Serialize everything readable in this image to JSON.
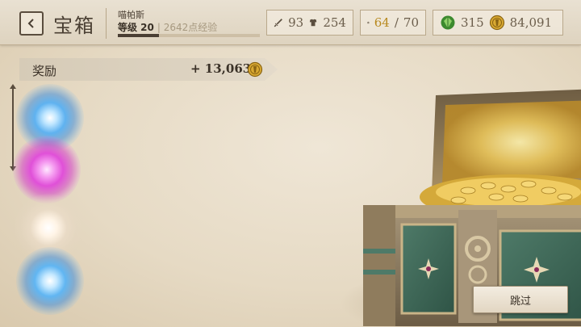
{
  "header": {
    "back_icon": "chevron-left-icon",
    "title": "宝箱",
    "player_name": "喵帕斯",
    "level_label": "等级 20",
    "xp_text": "| 2642点经验",
    "xp_progress": 0.29
  },
  "stats": {
    "attack": {
      "icon": "sword-icon",
      "value": "93"
    },
    "armor": {
      "icon": "armor-icon",
      "value": "254"
    },
    "inventory": {
      "icon": "backpack-icon",
      "current": "64",
      "separator": "/",
      "max": "70"
    },
    "gems": {
      "icon": "green-gem-icon",
      "value": "315"
    },
    "gold": {
      "icon": "gold-coin-icon",
      "value": "84,091"
    }
  },
  "reward": {
    "label": "奖励",
    "amount": "+ 13,063",
    "icon": "gold-coin-icon"
  },
  "reward_items": [
    {
      "name": "blue-magic-orb",
      "color": "#5fb2f0"
    },
    {
      "name": "pink-magic-orb",
      "color": "#e050d8"
    },
    {
      "name": "white-magic-orb",
      "color": "#f3e6d6"
    },
    {
      "name": "blue-magic-orb",
      "color": "#61b6f2"
    }
  ],
  "skip_button": {
    "label": "跳过"
  },
  "colors": {
    "text_dark": "#3a3127",
    "gold": "#b8891f",
    "chest_green": "#3f6b5a",
    "chest_bronze": "#8a7655"
  }
}
